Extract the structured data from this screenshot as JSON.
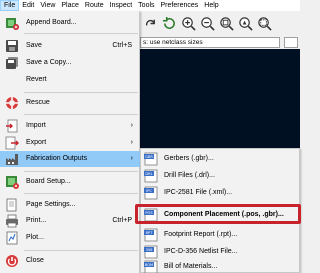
{
  "menubar": [
    {
      "label": "File",
      "active": true
    },
    {
      "label": "Edit"
    },
    {
      "label": "View"
    },
    {
      "label": "Place"
    },
    {
      "label": "Route"
    },
    {
      "label": "Inspect"
    },
    {
      "label": "Tools"
    },
    {
      "label": "Preferences"
    },
    {
      "label": "Help"
    }
  ],
  "toolbar": {
    "icons": [
      "redo-icon",
      "refresh-icon",
      "zoom-in-icon",
      "zoom-out-icon",
      "zoom-fit-icon",
      "zoom-to-objects-icon",
      "zoom-selection-icon"
    ]
  },
  "netbar": {
    "netclass_value": "s: use netclass sizes"
  },
  "file_menu": {
    "items": [
      {
        "label": "Append Board...",
        "icon": "append-board-icon"
      },
      {
        "label": "Save",
        "shortcut": "Ctrl+S",
        "icon": "save-icon"
      },
      {
        "label": "Save a Copy...",
        "icon": "save-copy-icon"
      },
      {
        "label": "Revert"
      },
      {
        "label": "Rescue",
        "icon": "rescue-icon"
      },
      {
        "label": "Import",
        "icon": "import-icon",
        "submenu": true
      },
      {
        "label": "Export",
        "icon": "export-icon",
        "submenu": true
      },
      {
        "label": "Fabrication Outputs",
        "icon": "fabrication-icon",
        "submenu": true,
        "highlighted": true
      },
      {
        "label": "Board Setup...",
        "icon": "board-setup-icon"
      },
      {
        "label": "Page Settings...",
        "icon": "page-settings-icon"
      },
      {
        "label": "Print...",
        "shortcut": "Ctrl+P",
        "icon": "print-icon"
      },
      {
        "label": "Plot...",
        "icon": "plot-icon"
      },
      {
        "label": "Close",
        "icon": "close-icon"
      }
    ],
    "submenu_arrow": "›"
  },
  "fab_submenu": {
    "items": [
      {
        "label": "Gerbers (.gbr)...",
        "badge": "GBR"
      },
      {
        "label": "Drill Files (.drl)...",
        "badge": "DRL"
      },
      {
        "label": "IPC-2581 File (.xml)...",
        "badge": "IPC"
      },
      {
        "label": "Component Placement (.pos, .gbr)...",
        "badge": "POS",
        "selected": true
      },
      {
        "label": "Footprint Report (.rpt)...",
        "badge": "RPT"
      },
      {
        "label": "IPC-D-356 Netlist File...",
        "badge": "356"
      },
      {
        "label": "Bill of Materials...",
        "badge": "BOM"
      }
    ]
  },
  "colors": {
    "highlight": "#91c9f7",
    "callout_border": "#c8232c",
    "canvas": "#001023"
  }
}
